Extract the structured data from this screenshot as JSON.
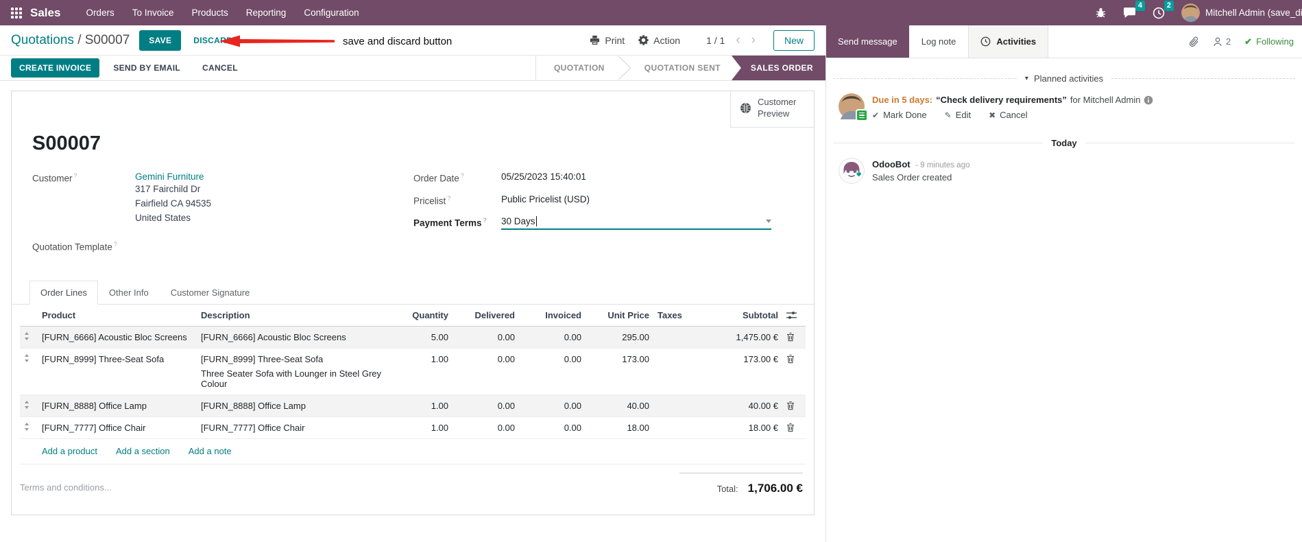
{
  "colors": {
    "navbar_bg": "#714B67",
    "primary_teal": "#017E84",
    "badge_teal": "#00A09D",
    "status_active_bg": "#714B67",
    "edited_value_blue": "#377DA8",
    "due_orange": "#CC7A2F",
    "following_green": "#3D8B41",
    "annotation_red": "#E8251F"
  },
  "navbar": {
    "brand": "Sales",
    "items": [
      "Orders",
      "To Invoice",
      "Products",
      "Reporting",
      "Configuration"
    ],
    "messages_badge": "4",
    "activities_badge": "2",
    "user": "Mitchell Admin (save_discar"
  },
  "control_panel": {
    "breadcrumb_parent": "Quotations",
    "breadcrumb_sep": "/",
    "breadcrumb_current": "S00007",
    "save_label": "SAVE",
    "discard_label": "DISCARD",
    "annotation": "save and discard button",
    "print_label": "Print",
    "action_label": "Action",
    "pager": "1 / 1",
    "prev": "‹",
    "next": "›",
    "new_label": "New"
  },
  "status_bar": {
    "create_invoice": "CREATE INVOICE",
    "send_by_email": "SEND BY EMAIL",
    "cancel": "CANCEL",
    "steps": [
      "QUOTATION",
      "QUOTATION SENT",
      "SALES ORDER"
    ],
    "active_step": "SALES ORDER"
  },
  "form": {
    "preview_label": "Customer Preview",
    "title": "S00007",
    "customer_label": "Customer",
    "help_sup": "?",
    "customer_name": "Gemini Furniture",
    "address": [
      "317 Fairchild Dr",
      "Fairfield CA 94535",
      "United States"
    ],
    "quotation_template_label": "Quotation Template",
    "order_date_label": "Order Date",
    "order_date": "05/25/2023 15:40:01",
    "pricelist_label": "Pricelist",
    "pricelist": "Public Pricelist (USD)",
    "payment_terms_label": "Payment Terms",
    "payment_terms": "30 Days"
  },
  "tabs": [
    "Order Lines",
    "Other Info",
    "Customer Signature"
  ],
  "order_lines": {
    "headers": {
      "product": "Product",
      "description": "Description",
      "quantity": "Quantity",
      "delivered": "Delivered",
      "invoiced": "Invoiced",
      "unit_price": "Unit Price",
      "taxes": "Taxes",
      "subtotal": "Subtotal"
    },
    "rows": [
      {
        "product": "[FURN_6666] Acoustic Bloc Screens",
        "desc1": "[FURN_6666] Acoustic Bloc Screens",
        "desc2": "",
        "quantity": "5.00",
        "delivered": "0.00",
        "invoiced": "0.00",
        "unit_price": "295.00",
        "taxes": "",
        "subtotal": "1,475.00 €"
      },
      {
        "product": "[FURN_8999] Three-Seat Sofa",
        "desc1": "[FURN_8999] Three-Seat Sofa",
        "desc2": "Three Seater Sofa with Lounger in Steel Grey Colour",
        "quantity": "1.00",
        "delivered": "0.00",
        "invoiced": "0.00",
        "unit_price": "173.00",
        "taxes": "",
        "subtotal": "173.00 €"
      },
      {
        "product": "[FURN_8888] Office Lamp",
        "desc1": "[FURN_8888] Office Lamp",
        "desc2": "",
        "quantity": "1.00",
        "delivered": "0.00",
        "invoiced": "0.00",
        "unit_price": "40.00",
        "taxes": "",
        "subtotal": "40.00 €"
      },
      {
        "product": "[FURN_7777] Office Chair",
        "desc1": "[FURN_7777] Office Chair",
        "desc2": "",
        "quantity": "1.00",
        "delivered": "0.00",
        "invoiced": "0.00",
        "unit_price": "18.00",
        "taxes": "",
        "subtotal": "18.00 €"
      }
    ],
    "footer_links": [
      "Add a product",
      "Add a section",
      "Add a note"
    ],
    "terms_placeholder": "Terms and conditions...",
    "total_label": "Total:",
    "total_value": "1,706.00 €"
  },
  "chatter": {
    "send_message": "Send message",
    "log_note": "Log note",
    "activities": "Activities",
    "followers_count": "2",
    "following": "Following",
    "planned_title": "Planned activities",
    "activity": {
      "due": "Due in 5 days:",
      "summary": "“Check delivery requirements”",
      "for_text": "for Mitchell Admin",
      "mark_done": "Mark Done",
      "edit": "Edit",
      "cancel": "Cancel"
    },
    "today": "Today",
    "message": {
      "author": "OdooBot",
      "time": "- 9 minutes ago",
      "body": "Sales Order created"
    }
  }
}
